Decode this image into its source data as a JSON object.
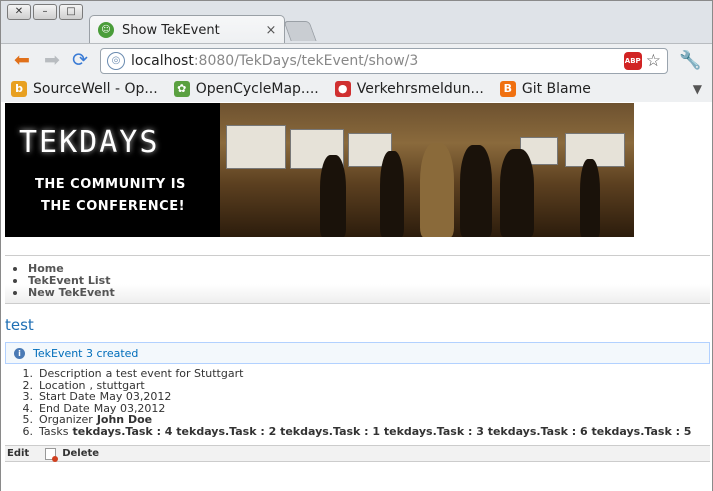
{
  "browser": {
    "tab_title": "Show TekEvent",
    "tab_close": "×",
    "url_host": "localhost",
    "url_rest": ":8080/TekDays/tekEvent/show/3",
    "abp_label": "ABP",
    "bookmarks": [
      {
        "label": "SourceWell - Op...",
        "icon": "b",
        "color": "#e8a020"
      },
      {
        "label": "OpenCycleMap....",
        "icon": "✿",
        "color": "#5aa040"
      },
      {
        "label": "Verkehrsmeldun...",
        "icon": "●",
        "color": "#d03030"
      },
      {
        "label": "Git Blame",
        "icon": "B",
        "color": "#f07010"
      }
    ]
  },
  "banner": {
    "brand": "TEKDAYS",
    "tagline1": "THE COMMUNITY IS",
    "tagline2": "THE CONFERENCE!"
  },
  "nav": {
    "items": [
      "Home",
      "TekEvent List",
      "New TekEvent"
    ]
  },
  "page": {
    "title": "test",
    "message": "TekEvent 3 created"
  },
  "properties": [
    {
      "num": "1.",
      "label": "Description",
      "value": "a test event for Stuttgart",
      "bold": false
    },
    {
      "num": "2.",
      "label": "Location",
      "value": ", stuttgart",
      "bold": false
    },
    {
      "num": "3.",
      "label": "Start Date",
      "value": "May 03,2012",
      "bold": false
    },
    {
      "num": "4.",
      "label": "End Date",
      "value": "May 03,2012",
      "bold": false
    },
    {
      "num": "5.",
      "label": "Organizer",
      "value": "John Doe",
      "bold": true
    },
    {
      "num": "6.",
      "label": "Tasks",
      "value": "tekdays.Task : 4 tekdays.Task : 2 tekdays.Task : 1 tekdays.Task : 3 tekdays.Task : 6 tekdays.Task : 5",
      "bold": true
    }
  ],
  "buttons": {
    "edit": "Edit",
    "delete": "Delete"
  }
}
